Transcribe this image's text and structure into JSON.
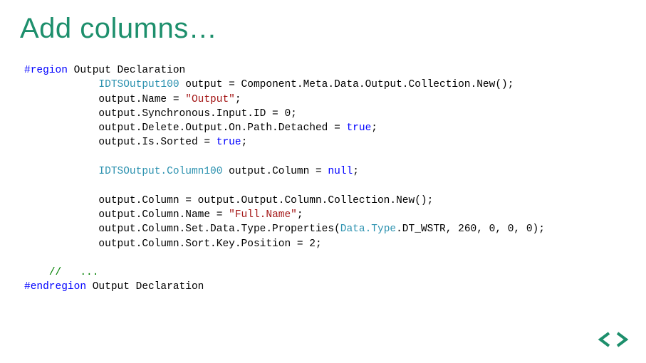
{
  "title": "Add columns…",
  "code": {
    "region_open": "#region",
    "region_label": " Output Declaration",
    "indent": "            ",
    "l1a": " output = Component.Meta.Data.Output.Collection.New();",
    "l2": "output.Name = ",
    "l2s": "\"Output\"",
    "l2b": ";",
    "l3": "output.Synchronous.Input.ID = 0;",
    "l4a": "output.Delete.Output.On.Path.Detached = ",
    "l4b": "true",
    "l4c": ";",
    "l5a": "output.Is.Sorted = ",
    "l5b": "true",
    "l5c": ";",
    "l6a": " output.Column = ",
    "l6b": "null",
    "l6c": ";",
    "l7": "output.Column = output.Output.Column.Collection.New();",
    "l8a": "output.Column.Name = ",
    "l8s": "\"Full.Name\"",
    "l8b": ";",
    "l9a": "output.Column.Set.Data.Type.Properties(",
    "l9b": "Data.Type",
    "l9c": ".DT_WSTR, 260, 0, 0, 0);",
    "l10": "output.Column.Sort.Key.Position = 2;",
    "cmt_indent": "    ",
    "cmt": "//   ...",
    "region_close": "#endregion",
    "region_close_label": " Output Declaration",
    "type_output": "IDTSOutput100",
    "type_column": "IDTSOutput.Column100"
  },
  "logo": {
    "color": "#1d8f6c"
  }
}
